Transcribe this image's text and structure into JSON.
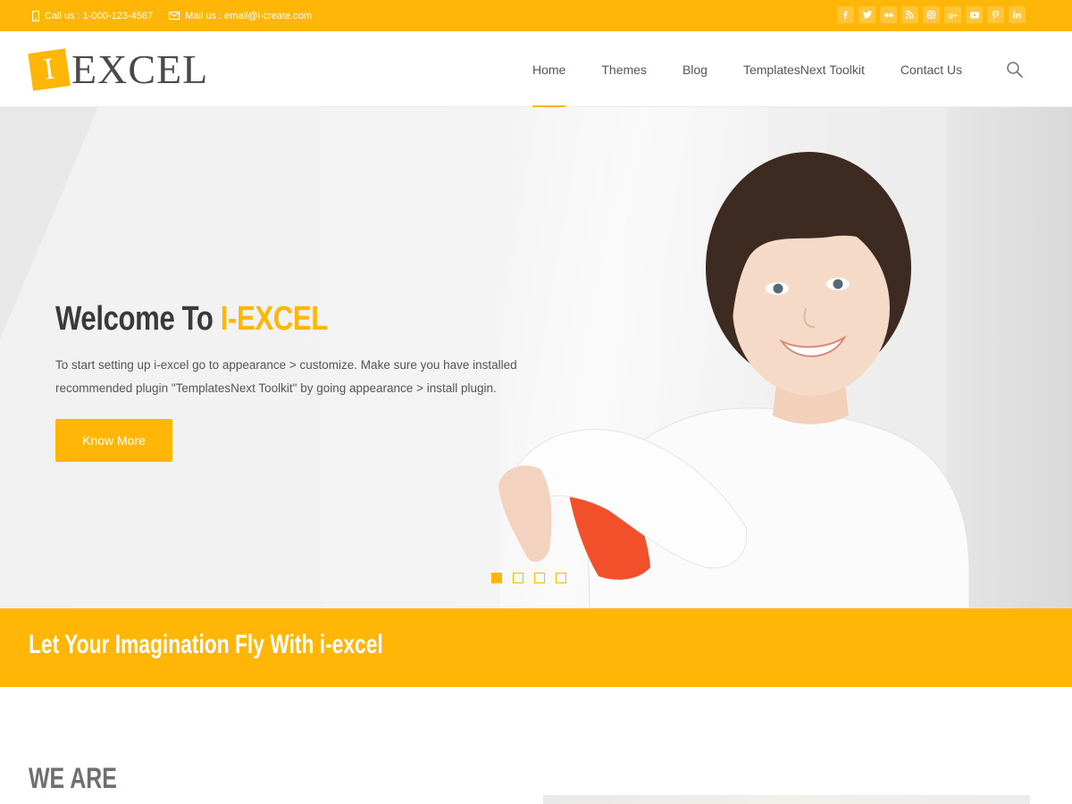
{
  "topbar": {
    "phone": "Call us : 1-000-123-4567",
    "email": "Mail us : email@i-create.com",
    "social": [
      "facebook-icon",
      "twitter-icon",
      "flickr-icon",
      "rss-icon",
      "instagram-icon",
      "google-plus-icon",
      "youtube-icon",
      "pinterest-icon",
      "linkedin-icon"
    ]
  },
  "header": {
    "logo_mark": "I",
    "logo_text": "EXCEL",
    "nav": [
      {
        "label": "Home",
        "active": true
      },
      {
        "label": "Themes",
        "active": false
      },
      {
        "label": "Blog",
        "active": false
      },
      {
        "label": "TemplatesNext Toolkit",
        "active": false
      },
      {
        "label": "Contact Us",
        "active": false
      }
    ]
  },
  "hero": {
    "title_prefix": "Welcome To ",
    "title_accent": "I-EXCEL",
    "text": "To start setting up i-excel go to appearance > customize. Make sure you have installed recommended plugin \"TemplatesNext Toolkit\" by going appearance > install plugin.",
    "button": "Know More",
    "slide_count": 4,
    "active_slide": 1
  },
  "band": {
    "text": "Let Your Imagination Fly With i-excel"
  },
  "section": {
    "heading": "WE ARE"
  },
  "colors": {
    "accent": "#ffb606",
    "text": "#444444"
  }
}
